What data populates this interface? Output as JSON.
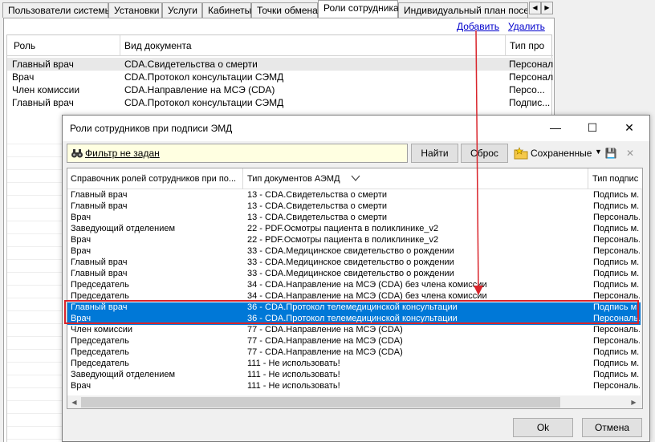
{
  "tabs": [
    "Пользователи системы",
    "Установки",
    "Услуги",
    "Кабинеты",
    "Точки обмена",
    "Роли сотрудника",
    "Индивидуальный план посеще"
  ],
  "background": {
    "add_link": "Добавить",
    "delete_link": "Удалить",
    "columns": [
      "Роль",
      "Вид документа",
      "Тип про"
    ],
    "rows": [
      {
        "role": "Главный врач",
        "doc": "CDA.Свидетельства о смерти",
        "type": "Персонал"
      },
      {
        "role": "Врач",
        "doc": "CDA.Протокол консультации СЭМД",
        "type": "Персонал"
      },
      {
        "role": "Член комиссии",
        "doc": "CDA.Направление на МСЭ (CDA)",
        "type": "Персо..."
      },
      {
        "role": "Главный врач",
        "doc": "CDA.Протокол консультации СЭМД",
        "type": "Подпис..."
      }
    ]
  },
  "dialog": {
    "title": "Роли сотрудников при подписи ЭМД",
    "filter_label": "Фильтр не задан",
    "find_button": "Найти",
    "reset_button": "Сброс",
    "saved_label": "Сохраненные",
    "ok_button": "Ok",
    "cancel_button": "Отмена",
    "columns": [
      "Справочник ролей сотрудников при по...",
      "Тип документов АЭМД",
      "Тип подпис"
    ],
    "rows": [
      {
        "role": "Главный врач",
        "doc": "13 - CDA.Свидетельства о смерти",
        "type": "Подпись м..."
      },
      {
        "role": "Главный врач",
        "doc": "13 - CDA.Свидетельства о смерти",
        "type": "Подпись м..."
      },
      {
        "role": "Врач",
        "doc": "13 - CDA.Свидетельства о смерти",
        "type": "Персональ..."
      },
      {
        "role": "Заведующий отделением",
        "doc": "22 - PDF.Осмотры пациента в поликлинике_v2",
        "type": "Подпись м..."
      },
      {
        "role": "Врач",
        "doc": "22 - PDF.Осмотры пациента в поликлинике_v2",
        "type": "Персональ..."
      },
      {
        "role": "Врач",
        "doc": "33 - CDA.Медицинское свидетельство о рождении",
        "type": "Персональ..."
      },
      {
        "role": "Главный врач",
        "doc": "33 - CDA.Медицинское свидетельство о рождении",
        "type": "Подпись м..."
      },
      {
        "role": "Главный врач",
        "doc": "33 - CDA.Медицинское свидетельство о рождении",
        "type": "Подпись м..."
      },
      {
        "role": "Председатель",
        "doc": "34 - CDA.Направление на МСЭ (CDA) без члена комиссии",
        "type": "Подпись м..."
      },
      {
        "role": "Председатель",
        "doc": "34 - CDA.Направление на МСЭ (CDA) без члена комиссии",
        "type": "Персональ..."
      },
      {
        "role": "Главный врач",
        "doc": "36 - CDA.Протокол телемедицинской консультации",
        "type": "Подпись м..."
      },
      {
        "role": "Врач",
        "doc": "36 - CDA.Протокол телемедицинской консультации",
        "type": "Персональ..."
      },
      {
        "role": "Член комиссии",
        "doc": "77 - CDA.Направление на МСЭ (CDA)",
        "type": "Персональ..."
      },
      {
        "role": "Председатель",
        "doc": "77 - CDA.Направление на МСЭ (CDA)",
        "type": "Персональ..."
      },
      {
        "role": "Председатель",
        "doc": "77 - CDA.Направление на МСЭ (CDA)",
        "type": "Подпись м..."
      },
      {
        "role": "Председатель",
        "doc": "111 - Не использовать!",
        "type": "Подпись м..."
      },
      {
        "role": "Заведующий отделением",
        "doc": "111 - Не использовать!",
        "type": "Подпись м..."
      },
      {
        "role": "Врач",
        "doc": "111 - Не использовать!",
        "type": "Персональ..."
      }
    ],
    "selected_rows": [
      10,
      11
    ]
  },
  "colors": {
    "selection": "#0078d7",
    "annotation": "#d9242b",
    "filter_bg": "#ffffe1"
  }
}
